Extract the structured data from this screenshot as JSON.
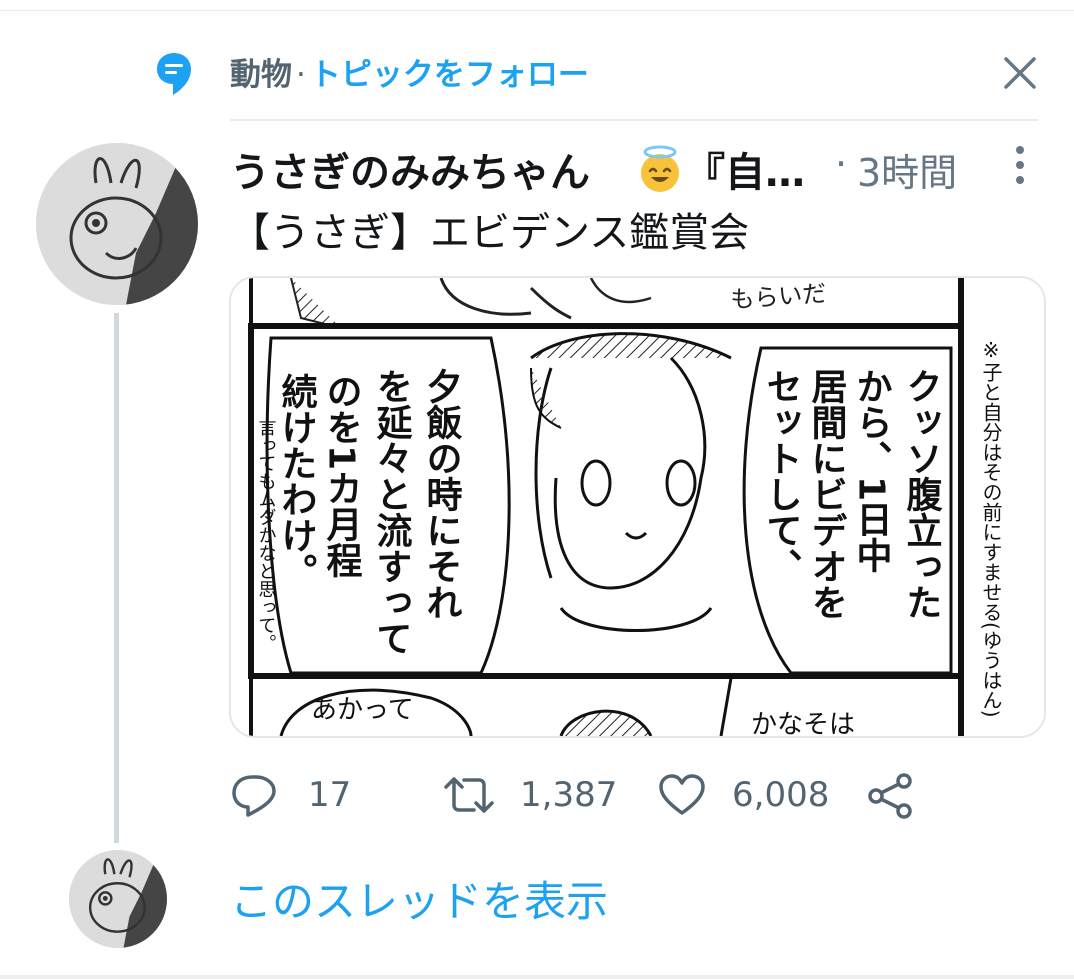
{
  "topic": {
    "name": "動物",
    "separator": "·",
    "follow_label": "トピックをフォロー"
  },
  "tweet": {
    "author_name": "うさぎのみみちゃん",
    "author_name_tail": "『自…",
    "dot": "·",
    "time": "3時間",
    "text": "【うさぎ】エビデンス鑑賞会"
  },
  "media_text": {
    "center_balloon": [
      "夕飯の時にそれ",
      "を延々と流すって",
      "のを1カ月程",
      "続けたわけ。"
    ],
    "center_small": "言ってもムダかなと思って。",
    "right_balloon": [
      "クッソ腹立った",
      "から、1日中",
      "居間にビデオを",
      "セットして、"
    ],
    "right_margin": "※子と自分はその前にすませる(ゆうはん)",
    "top_fragment": "もらいだ",
    "bottom_left": "あかって",
    "bottom_right": "かなそは"
  },
  "actions": {
    "reply_count": "17",
    "retweet_count": "1,387",
    "like_count": "6,008"
  },
  "show_thread_label": "このスレッドを表示",
  "colors": {
    "accent": "#1da1f2",
    "secondary_text": "#536471",
    "primary_text": "#14171a"
  }
}
